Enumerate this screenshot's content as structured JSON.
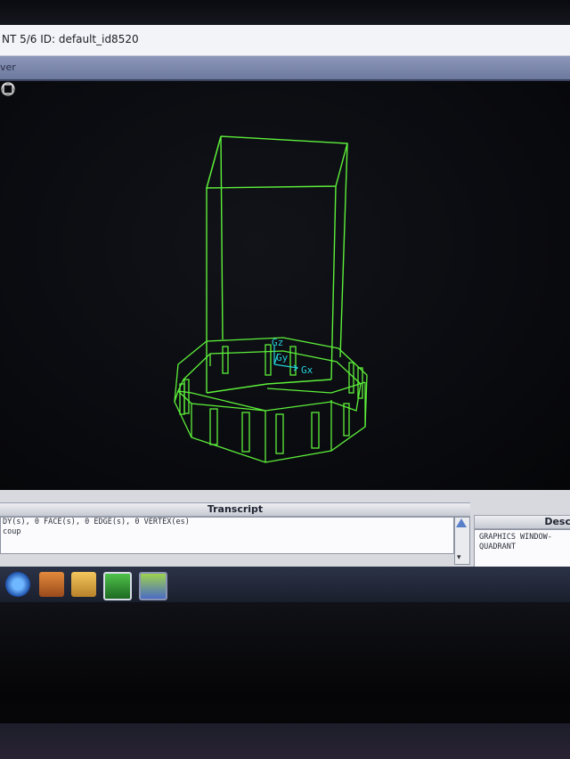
{
  "window": {
    "title": "NT 5/6   ID: default_id8520",
    "menu_fragment": "ver"
  },
  "transcript": {
    "header": "Transcript",
    "lines": [
      "DY(s), 0 FACE(s), 0 EDGE(s), 0 VERTEX(es)",
      "coup"
    ]
  },
  "description": {
    "header": "Desc",
    "lines": [
      "GRAPHICS WINDOW-",
      "QUADRANT"
    ]
  },
  "axes": {
    "z_label": "Gz",
    "y_label": "Gy",
    "x_label": "Gx"
  },
  "colors": {
    "wireframe": "#5df03a",
    "axis": "#23d0d8",
    "background": "#090a0e"
  },
  "taskbar": {
    "icons": [
      "browser-icon",
      "user-tools-icon",
      "package-icon",
      "gambit-app-icon",
      "active-app-icon"
    ]
  }
}
